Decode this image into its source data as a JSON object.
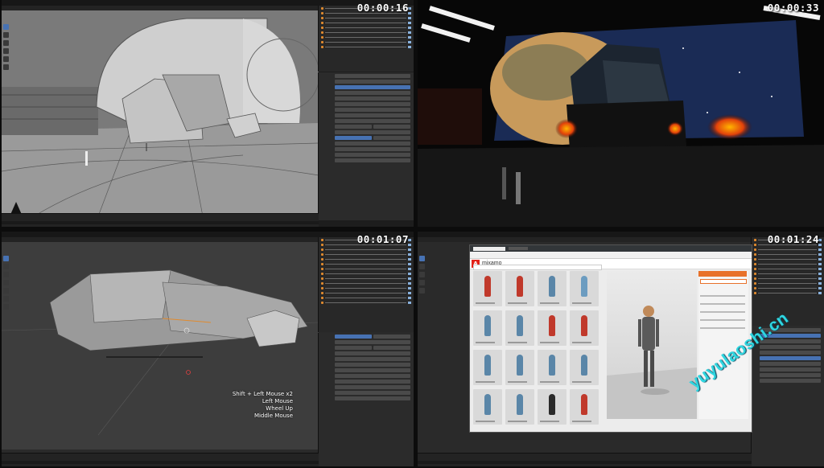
{
  "timestamps": {
    "top_left": "00:00:16",
    "top_right": "00:00:33",
    "bottom_left": "00:01:07",
    "bottom_right": "00:01:24"
  },
  "viewport_hints": [
    "Shift + Left Mouse x2",
    "Left Mouse",
    "Wheel Up",
    "Middle Mouse"
  ],
  "mixamo": {
    "brand": "mixamo",
    "logo_letter": "A"
  },
  "watermark": "yuyulaoshi.cn",
  "colors": {
    "blender_accent": "#4772b3",
    "mixamo_red": "#e2231a",
    "download_orange": "#e8712a",
    "watermark_cyan": "#2fd6e0"
  }
}
